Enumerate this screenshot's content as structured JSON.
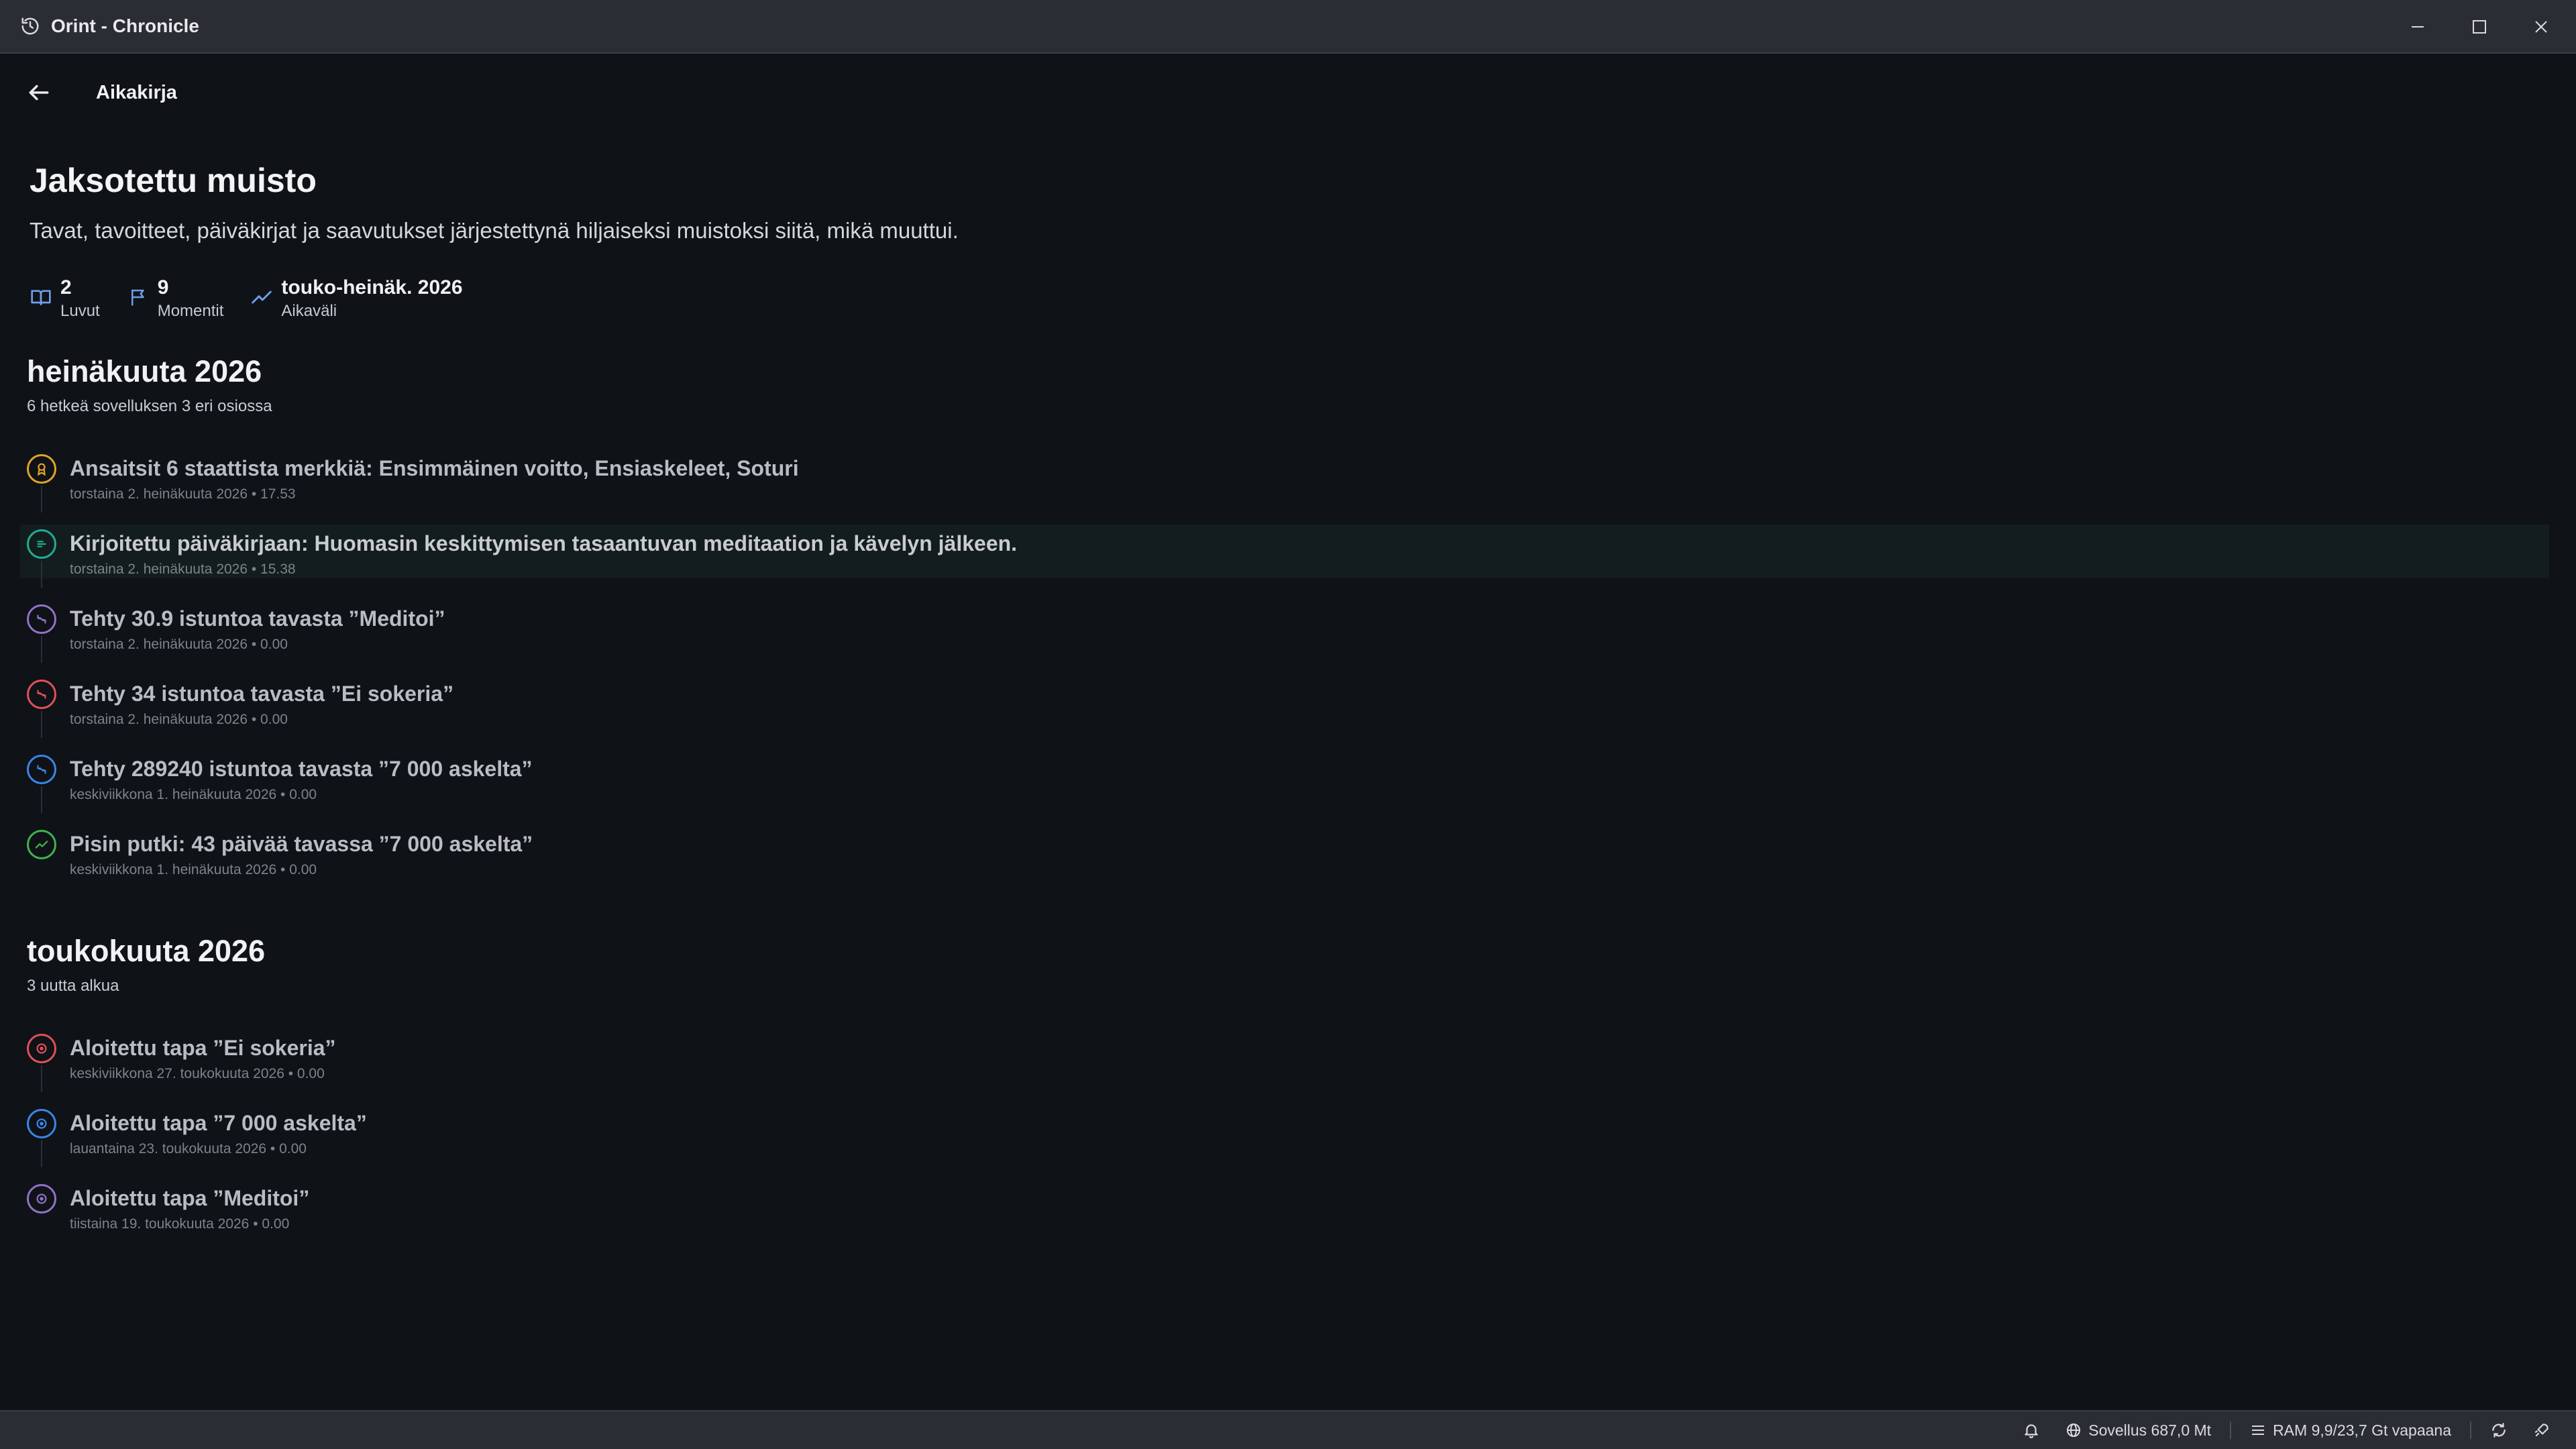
{
  "window": {
    "title": "Orint - Chronicle"
  },
  "header": {
    "title": "Aikakirja"
  },
  "hero": {
    "title": "Jaksotettu muisto",
    "subtitle": "Tavat, tavoitteet, päiväkirjat ja saavutukset järjestettynä hiljaiseksi muistoksi siitä, mikä muuttui."
  },
  "stats": [
    {
      "icon": "book-icon",
      "value": "2",
      "label": "Luvut"
    },
    {
      "icon": "flag-icon",
      "value": "9",
      "label": "Momentit"
    },
    {
      "icon": "trend-icon",
      "value": "touko-heinäk. 2026",
      "label": "Aikaväli"
    }
  ],
  "sections": [
    {
      "title": "heinäkuuta 2026",
      "subtitle": "6 hetkeä sovelluksen 3 eri osiossa",
      "events": [
        {
          "icon": "badge-icon",
          "color": "#e0a526",
          "title": "Ansaitsit 6 staattista merkkiä: Ensimmäinen voitto, Ensiaskeleet, Soturi",
          "time": "torstaina 2. heinäkuuta 2026 • 17.53"
        },
        {
          "icon": "journal-icon",
          "color": "#1fae97",
          "title": "Kirjoitettu päiväkirjaan: Huomasin keskittymisen tasaantuvan meditaation ja kävelyn jälkeen.",
          "time": "torstaina 2. heinäkuuta 2026 • 15.38",
          "highlight": true
        },
        {
          "icon": "repeat-icon",
          "color": "#9272c8",
          "title": "Tehty 30.9 istuntoa tavasta ”Meditoi”",
          "time": "torstaina 2. heinäkuuta 2026 • 0.00"
        },
        {
          "icon": "repeat-icon",
          "color": "#e0505a",
          "title": "Tehty 34 istuntoa tavasta ”Ei sokeria”",
          "time": "torstaina 2. heinäkuuta 2026 • 0.00"
        },
        {
          "icon": "repeat-icon",
          "color": "#3a86e8",
          "title": "Tehty 289240 istuntoa tavasta ”7 000 askelta”",
          "time": "keskiviikkona 1. heinäkuuta 2026 • 0.00"
        },
        {
          "icon": "streak-icon",
          "color": "#3fb34f",
          "title": "Pisin putki: 43 päivää tavassa ”7 000 askelta”",
          "time": "keskiviikkona 1. heinäkuuta 2026 • 0.00"
        }
      ]
    },
    {
      "title": "toukokuuta 2026",
      "subtitle": "3 uutta alkua",
      "events": [
        {
          "icon": "start-icon",
          "color": "#e0505a",
          "title": "Aloitettu tapa ”Ei sokeria”",
          "time": "keskiviikkona 27. toukokuuta 2026 • 0.00"
        },
        {
          "icon": "start-icon",
          "color": "#3a86e8",
          "title": "Aloitettu tapa ”7 000 askelta”",
          "time": "lauantaina 23. toukokuuta 2026 • 0.00"
        },
        {
          "icon": "start-icon",
          "color": "#9272c8",
          "title": "Aloitettu tapa ”Meditoi”",
          "time": "tiistaina 19. toukokuuta 2026 • 0.00"
        }
      ]
    }
  ],
  "statusbar": {
    "app_memory": "Sovellus 687,0 Mt",
    "ram": "RAM 9,9/23,7 Gt vapaana"
  }
}
